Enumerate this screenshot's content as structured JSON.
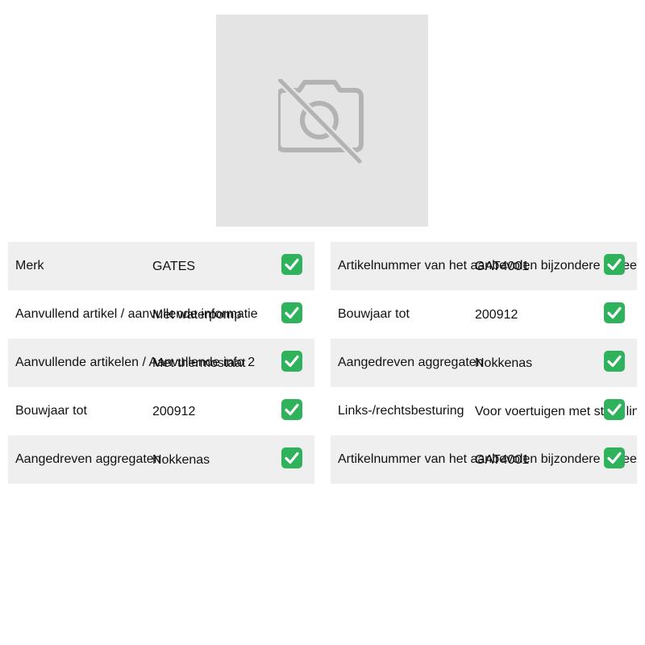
{
  "image": {
    "icon": "camera-off-icon"
  },
  "colors": {
    "check": "#2eb35c",
    "row_shade": "#efefef",
    "placeholder": "#e4e4e4"
  },
  "left_specs": [
    {
      "label": "Merk",
      "value": "GATES",
      "icon": "check-icon"
    },
    {
      "label": "Aanvullend artikel / aanvullende informatie",
      "value": "Met waterpomp",
      "icon": "check-icon"
    },
    {
      "label": "Aanvullende artikelen / Aanvullende info 2",
      "value": "Met thermostaat",
      "icon": "check-icon"
    },
    {
      "label": "Bouwjaar tot",
      "value": "200912",
      "icon": "check-icon"
    },
    {
      "label": "Aangedreven aggregaten",
      "value": "Nokkenas",
      "icon": "check-icon"
    }
  ],
  "right_specs": [
    {
      "label": "Artikelnummer van het aanbevolen bijzondere gereedschap",
      "value": "GAT4001",
      "icon": "check-icon"
    },
    {
      "label": "Bouwjaar tot",
      "value": "200912",
      "icon": "check-icon"
    },
    {
      "label": "Aangedreven aggregaten",
      "value": "Nokkenas",
      "icon": "check-icon"
    },
    {
      "label": "Links-/rechtsbesturing",
      "value": "Voor voertuigen met stuur links",
      "icon": "check-icon"
    },
    {
      "label": "Artikelnummer van het aanbevolen bijzondere gereedschap",
      "value": "GAT4001",
      "icon": "check-icon"
    }
  ]
}
